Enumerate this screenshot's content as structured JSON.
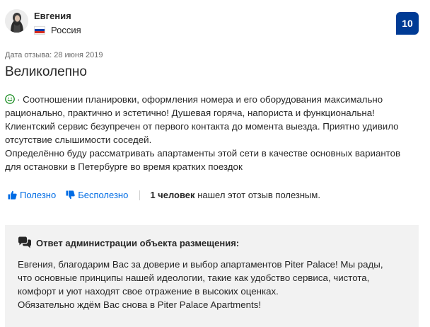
{
  "reviewer": {
    "name": "Евгения",
    "country": "Россия",
    "flag_colors": [
      "#ffffff",
      "#0039a6",
      "#d52b1e"
    ]
  },
  "score": "10",
  "review": {
    "date": "Дата отзыва: 28 июня 2019",
    "title": "Великолепно",
    "positive_lines": [
      "· Соотношении планировки, оформления номера и его оборудования максимально",
      "рационально, практично и эстетично! Душевая горяча, напориста и функциональна!",
      "Клиентский сервис безупречен от первого контакта до момента выезда. Приятно удивило",
      "отсутствие слышимости соседей.",
      "Определённо буду рассматривать апартаменты этой сети в качестве основных вариантов",
      "для остановки в Петербурге во время кратких поездок"
    ]
  },
  "votes": {
    "helpful_label": "Полезно",
    "not_helpful_label": "Бесполезно",
    "count_bold": "1 человек",
    "count_rest": "нашел этот отзыв полезным."
  },
  "response": {
    "title": "Ответ администрации объекта размещения:",
    "lines": [
      "Евгения, благодарим Вас за доверие и выбор апартаментов Piter Palace! Мы рады,",
      "что основные принципы нашей идеологии, такие как удобство сервиса, чистота,",
      "комфорт и уют находят свое отражение в высоких оценках.",
      "Обязательно ждём Вас снова в Piter Palace Apartments!"
    ]
  },
  "colors": {
    "accent": "#006ce4",
    "score_bg": "#003b95",
    "positive": "#008009",
    "response_bg": "#f2f2f2"
  }
}
